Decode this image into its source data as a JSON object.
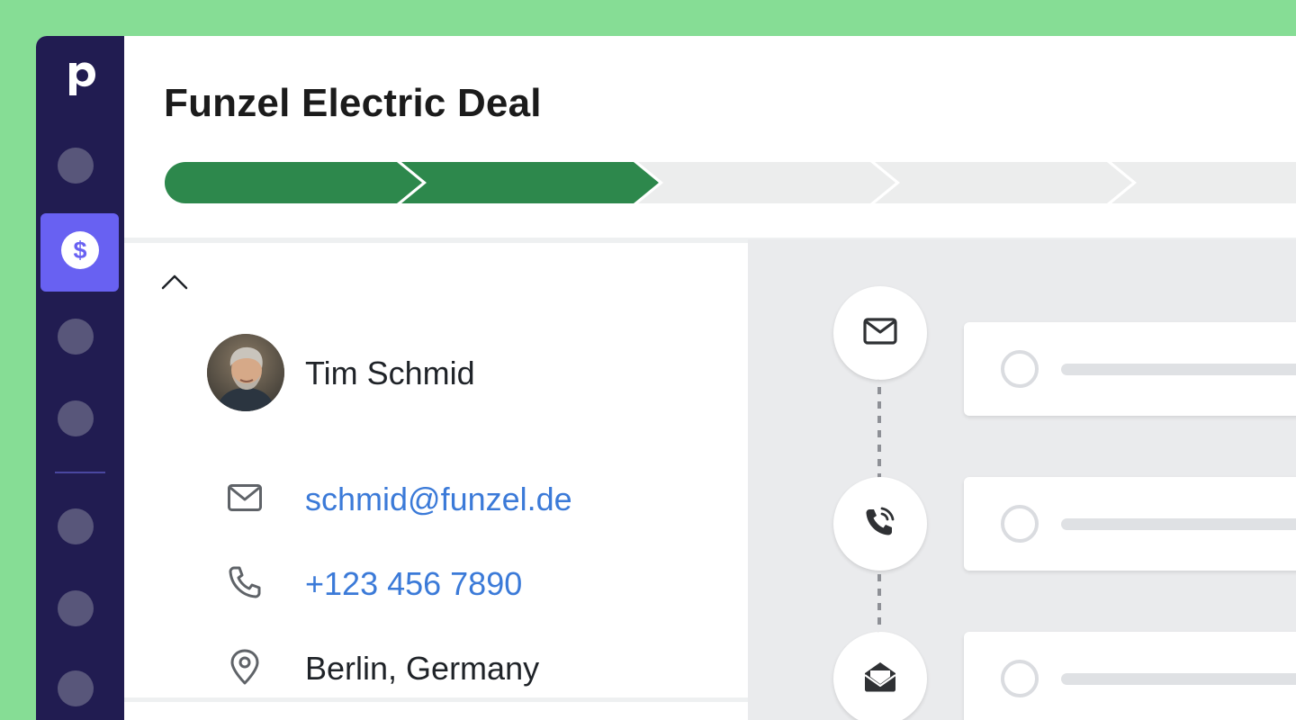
{
  "app": {
    "logo_letter": "p",
    "brand_color": "#86dd95"
  },
  "sidebar": {
    "background": "#211c51",
    "active_item": "deals",
    "active_icon": "dollar-icon",
    "active_color": "#6861f2"
  },
  "deal": {
    "title": "Funzel Electric Deal",
    "pipeline": {
      "total_stages": 5,
      "completed_stages": 2,
      "completed_color": "#2d884c",
      "pending_color": "#eceded"
    }
  },
  "contact": {
    "name": "Tim Schmid",
    "email": "schmid@funzel.de",
    "phone": "+123 456 7890",
    "location": "Berlin, Germany",
    "collapse_icon": "chevron-up-icon",
    "icons": [
      "mail-icon",
      "phone-icon",
      "location-pin-icon"
    ]
  },
  "activities": [
    {
      "type": "email",
      "icon": "envelope-icon",
      "done": false
    },
    {
      "type": "call",
      "icon": "phone-call-icon",
      "done": false
    },
    {
      "type": "inbox",
      "icon": "inbox-icon",
      "done": false
    }
  ]
}
